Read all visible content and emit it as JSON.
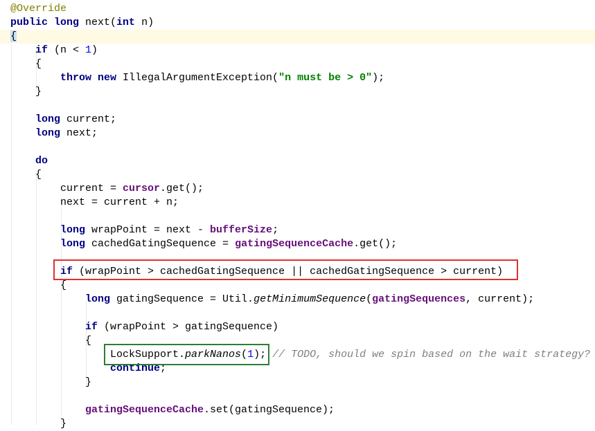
{
  "editor": {
    "current_line": 2,
    "lines": [
      {
        "indent": 0,
        "segs": [
          [
            "ann",
            "@Override"
          ]
        ]
      },
      {
        "indent": 0,
        "segs": [
          [
            "kw",
            "public long "
          ],
          [
            "plain",
            "next("
          ],
          [
            "kw",
            "int "
          ],
          [
            "plain",
            "n)"
          ]
        ]
      },
      {
        "indent": 0,
        "segs": [
          [
            "brace-match",
            "{"
          ]
        ]
      },
      {
        "indent": 1,
        "segs": [
          [
            "kw",
            "if "
          ],
          [
            "plain",
            "(n < "
          ],
          [
            "num",
            "1"
          ],
          [
            "plain",
            ")"
          ]
        ]
      },
      {
        "indent": 1,
        "segs": [
          [
            "plain",
            "{"
          ]
        ]
      },
      {
        "indent": 2,
        "segs": [
          [
            "kw",
            "throw new "
          ],
          [
            "plain",
            "IllegalArgumentException("
          ],
          [
            "str",
            "\"n must be > 0\""
          ],
          [
            "plain",
            ");"
          ]
        ]
      },
      {
        "indent": 1,
        "segs": [
          [
            "plain",
            "}"
          ]
        ]
      },
      {
        "indent": 0,
        "segs": []
      },
      {
        "indent": 1,
        "segs": [
          [
            "kw",
            "long "
          ],
          [
            "plain",
            "current;"
          ]
        ]
      },
      {
        "indent": 1,
        "segs": [
          [
            "kw",
            "long "
          ],
          [
            "plain",
            "next;"
          ]
        ]
      },
      {
        "indent": 0,
        "segs": []
      },
      {
        "indent": 1,
        "segs": [
          [
            "kw",
            "do"
          ]
        ]
      },
      {
        "indent": 1,
        "segs": [
          [
            "plain",
            "{"
          ]
        ]
      },
      {
        "indent": 2,
        "segs": [
          [
            "plain",
            "current = "
          ],
          [
            "field",
            "cursor"
          ],
          [
            "plain",
            ".get();"
          ]
        ]
      },
      {
        "indent": 2,
        "segs": [
          [
            "plain",
            "next = current + n;"
          ]
        ]
      },
      {
        "indent": 0,
        "segs": []
      },
      {
        "indent": 2,
        "segs": [
          [
            "kw",
            "long "
          ],
          [
            "plain",
            "wrapPoint = next - "
          ],
          [
            "field",
            "bufferSize"
          ],
          [
            "plain",
            ";"
          ]
        ]
      },
      {
        "indent": 2,
        "segs": [
          [
            "kw",
            "long "
          ],
          [
            "plain",
            "cachedGatingSequence = "
          ],
          [
            "field",
            "gatingSequenceCache"
          ],
          [
            "plain",
            ".get();"
          ]
        ]
      },
      {
        "indent": 0,
        "segs": []
      },
      {
        "indent": 2,
        "segs": [
          [
            "kw",
            "if "
          ],
          [
            "plain",
            "(wrapPoint > cachedGatingSequence || cachedGatingSequence > current)"
          ]
        ]
      },
      {
        "indent": 2,
        "segs": [
          [
            "plain",
            "{"
          ]
        ]
      },
      {
        "indent": 3,
        "segs": [
          [
            "kw",
            "long "
          ],
          [
            "plain",
            "gatingSequence = Util."
          ],
          [
            "ital",
            "getMinimumSequence"
          ],
          [
            "plain",
            "("
          ],
          [
            "field",
            "gatingSequences"
          ],
          [
            "plain",
            ", current);"
          ]
        ]
      },
      {
        "indent": 0,
        "segs": []
      },
      {
        "indent": 3,
        "segs": [
          [
            "kw",
            "if "
          ],
          [
            "plain",
            "(wrapPoint > gatingSequence)"
          ]
        ]
      },
      {
        "indent": 3,
        "segs": [
          [
            "plain",
            "{"
          ]
        ]
      },
      {
        "indent": 4,
        "segs": [
          [
            "plain",
            "LockSupport."
          ],
          [
            "ital",
            "parkNanos"
          ],
          [
            "plain",
            "("
          ],
          [
            "num",
            "1"
          ],
          [
            "plain",
            ");"
          ],
          [
            "comment",
            " // TODO, should we spin based on the wait strategy?"
          ]
        ]
      },
      {
        "indent": 4,
        "segs": [
          [
            "kw",
            "continue"
          ],
          [
            "plain",
            ";"
          ]
        ]
      },
      {
        "indent": 3,
        "segs": [
          [
            "plain",
            "}"
          ]
        ]
      },
      {
        "indent": 0,
        "segs": []
      },
      {
        "indent": 3,
        "segs": [
          [
            "field",
            "gatingSequenceCache"
          ],
          [
            "plain",
            ".set(gatingSequence);"
          ]
        ]
      },
      {
        "indent": 2,
        "segs": [
          [
            "plain",
            "}"
          ]
        ]
      }
    ]
  },
  "highlights": {
    "red_box_color": "#e03030",
    "green_box_color": "#2e7d32"
  }
}
